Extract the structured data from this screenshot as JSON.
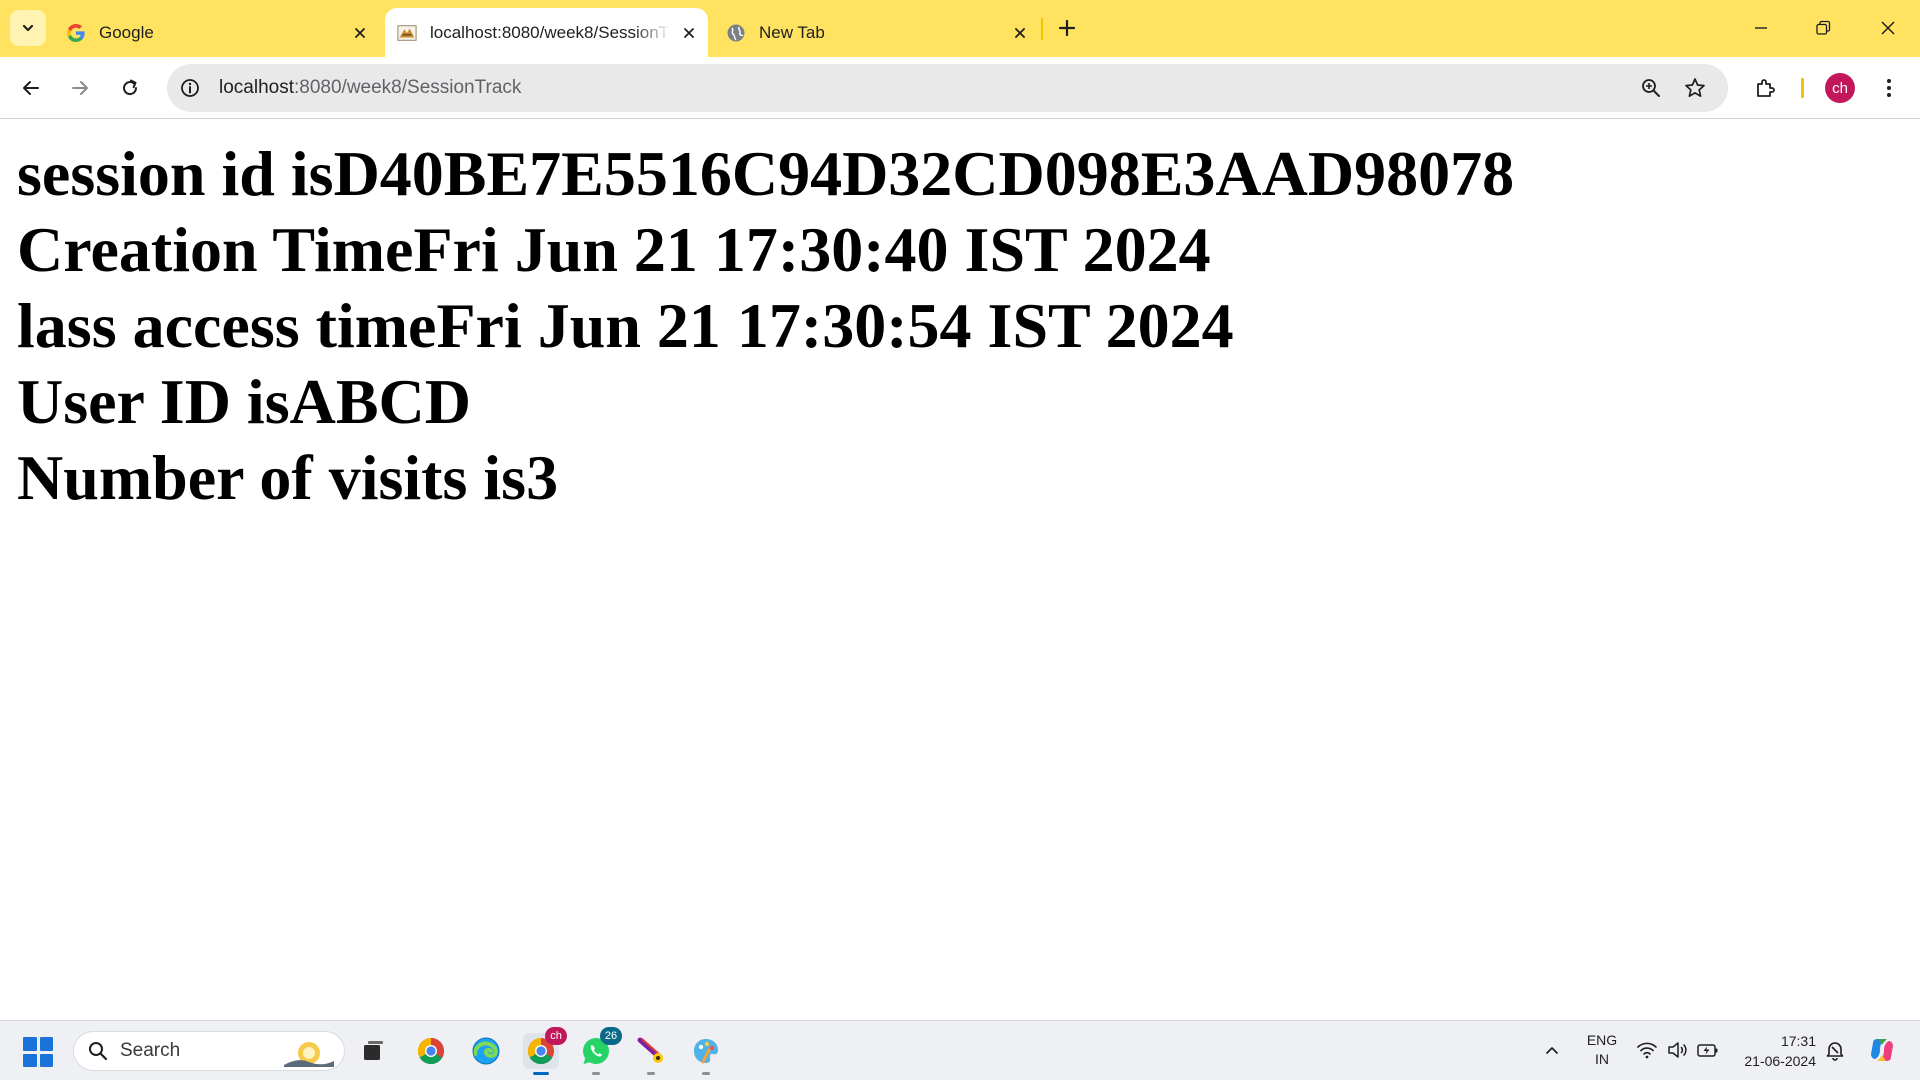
{
  "browser": {
    "tabs": [
      {
        "title": "Google",
        "favicon": "google-g-icon",
        "active": false
      },
      {
        "title": "localhost:8080/week8/SessionTrack",
        "favicon": "tomcat-icon",
        "active": true
      },
      {
        "title": "New Tab",
        "favicon": "globe-icon",
        "active": false
      }
    ],
    "address_bar": {
      "host": "localhost",
      "path": ":8080/week8/SessionTrack"
    },
    "profile_initials": "ch",
    "colors": {
      "frame": "#ffe260",
      "profile": "#c2185b"
    }
  },
  "page": {
    "lines": [
      "session id isD40BE7E5516C94D32CD098E3AAD98078",
      "Creation TimeFri Jun 21 17:30:40 IST 2024",
      "lass access timeFri Jun 21 17:30:54 IST 2024",
      "User ID isABCD",
      "Number of visits is3"
    ]
  },
  "taskbar": {
    "search_label": "Search",
    "whatsapp_badge": "26",
    "chrome_profile_badge": "ch",
    "language": {
      "line1": "ENG",
      "line2": "IN"
    },
    "clock": {
      "time": "17:31",
      "date": "21-06-2024"
    }
  }
}
